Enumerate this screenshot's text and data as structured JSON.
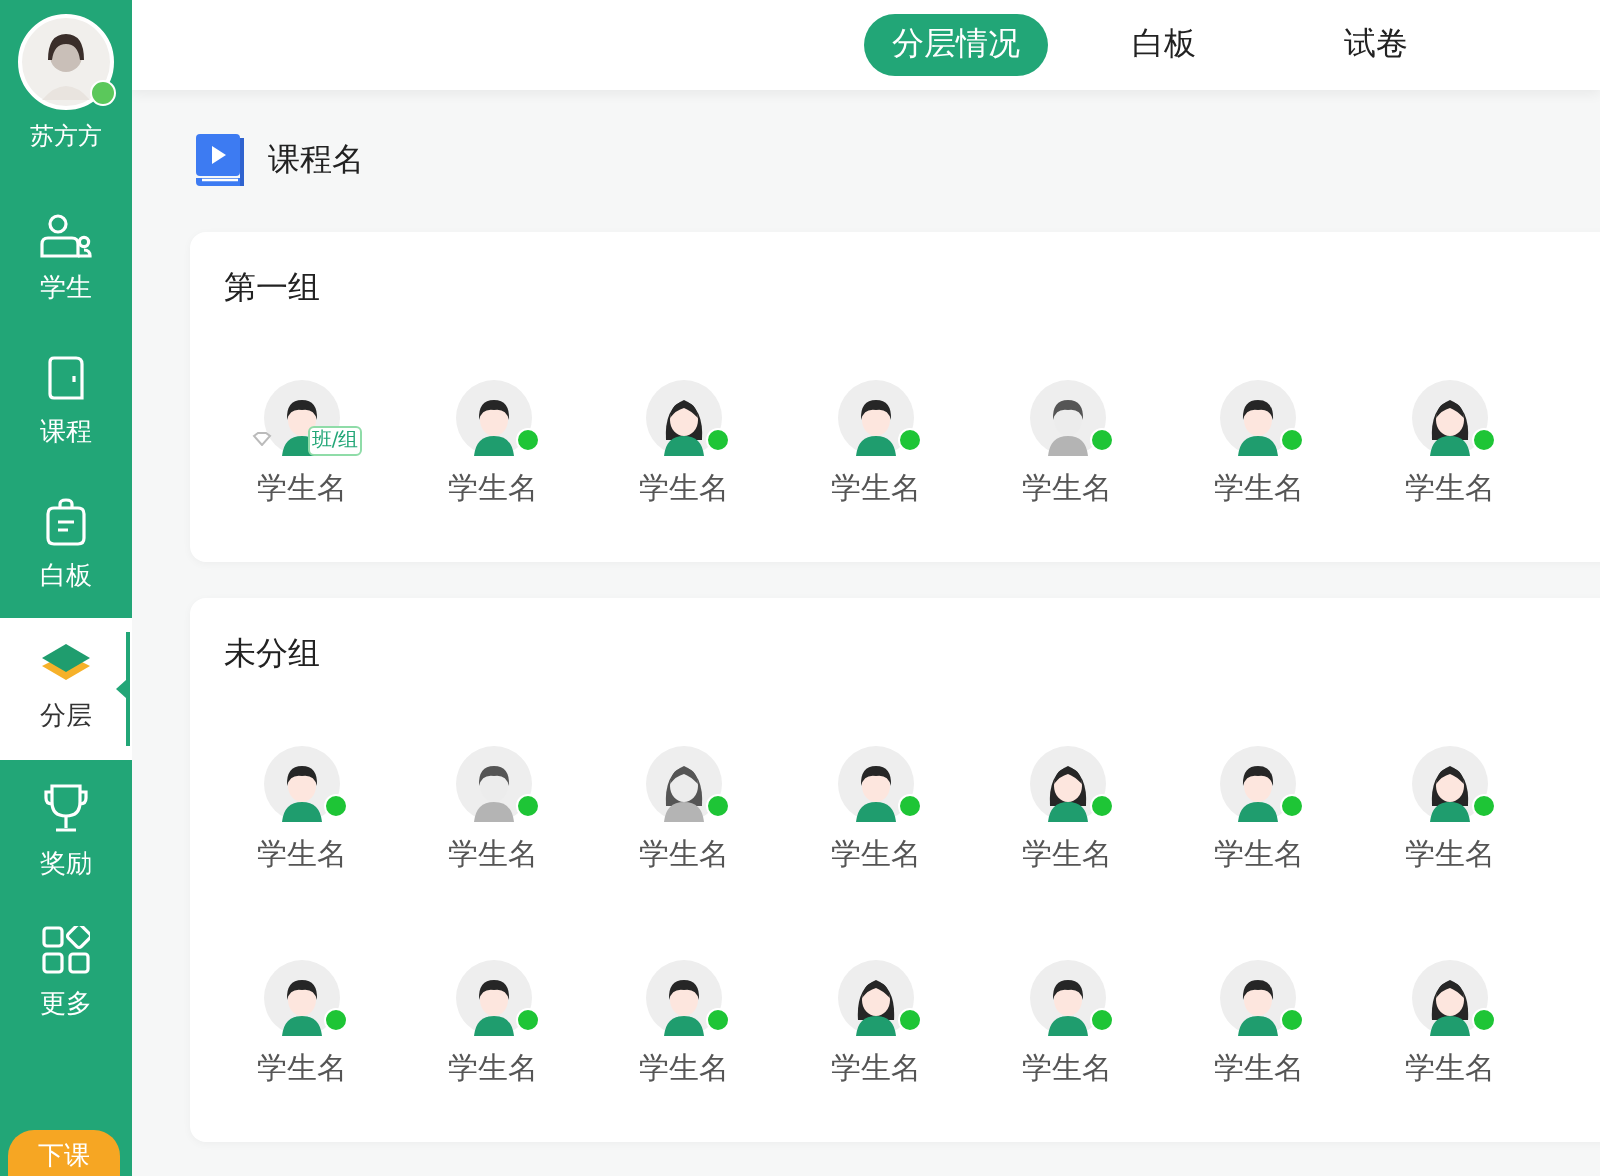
{
  "user": {
    "name": "苏方方",
    "online": true
  },
  "nav": [
    {
      "kind": "students",
      "label": "学生",
      "selected": false
    },
    {
      "kind": "course",
      "label": "课程",
      "selected": false
    },
    {
      "kind": "whiteboard",
      "label": "白板",
      "selected": false
    },
    {
      "kind": "layers",
      "label": "分层",
      "selected": true
    },
    {
      "kind": "award",
      "label": "奖励",
      "selected": false
    },
    {
      "kind": "more",
      "label": "更多",
      "selected": false
    }
  ],
  "end_button": "下课",
  "tabs": [
    {
      "label": "分层情况",
      "selected": true
    },
    {
      "label": "白板",
      "selected": false
    },
    {
      "label": "试卷",
      "selected": false
    }
  ],
  "course_title": "课程名",
  "groups": [
    {
      "title": "第一组",
      "students": [
        {
          "name": "学生名",
          "kind": "boy",
          "greyed": false,
          "online": false,
          "tag": "班/组"
        },
        {
          "name": "学生名",
          "kind": "boy",
          "greyed": false,
          "online": true
        },
        {
          "name": "学生名",
          "kind": "girl",
          "greyed": false,
          "online": true
        },
        {
          "name": "学生名",
          "kind": "boy",
          "greyed": false,
          "online": true
        },
        {
          "name": "学生名",
          "kind": "boy",
          "greyed": true,
          "online": true
        },
        {
          "name": "学生名",
          "kind": "boy",
          "greyed": false,
          "online": true
        },
        {
          "name": "学生名",
          "kind": "girl",
          "greyed": false,
          "online": true
        }
      ]
    },
    {
      "title": "未分组",
      "students": [
        {
          "name": "学生名",
          "kind": "boy",
          "greyed": false,
          "online": true
        },
        {
          "name": "学生名",
          "kind": "boy",
          "greyed": true,
          "online": true
        },
        {
          "name": "学生名",
          "kind": "girl",
          "greyed": true,
          "online": true
        },
        {
          "name": "学生名",
          "kind": "boy",
          "greyed": false,
          "online": true
        },
        {
          "name": "学生名",
          "kind": "girl",
          "greyed": false,
          "online": true
        },
        {
          "name": "学生名",
          "kind": "boy",
          "greyed": false,
          "online": true
        },
        {
          "name": "学生名",
          "kind": "girl",
          "greyed": false,
          "online": true
        },
        {
          "name": "学生名",
          "kind": "boy",
          "greyed": false,
          "online": true
        },
        {
          "name": "学生名",
          "kind": "boy",
          "greyed": false,
          "online": true
        },
        {
          "name": "学生名",
          "kind": "boy",
          "greyed": false,
          "online": true
        },
        {
          "name": "学生名",
          "kind": "girl",
          "greyed": false,
          "online": true
        },
        {
          "name": "学生名",
          "kind": "boy",
          "greyed": false,
          "online": true
        },
        {
          "name": "学生名",
          "kind": "boy",
          "greyed": false,
          "online": true
        },
        {
          "name": "学生名",
          "kind": "girl",
          "greyed": false,
          "online": true
        }
      ]
    }
  ]
}
